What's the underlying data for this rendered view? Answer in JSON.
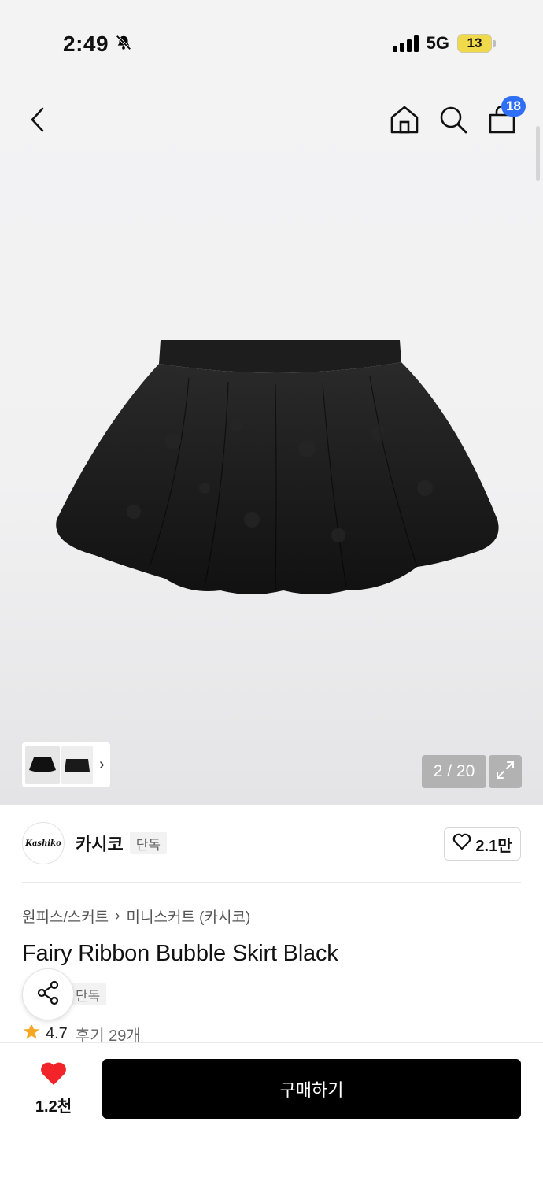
{
  "status_bar": {
    "time": "2:49",
    "network": "5G",
    "battery": "13"
  },
  "header": {
    "cart_count": "18",
    "icons": [
      "back-icon",
      "home-icon",
      "search-icon",
      "shopping-bag-icon"
    ]
  },
  "gallery": {
    "page_indicator": "2 / 20",
    "current_page": 2,
    "total_pages": 20
  },
  "brand": {
    "logo_text": "Kashiko",
    "name": "카시코",
    "tag": "단독",
    "likes": "2.1만"
  },
  "product": {
    "breadcrumb": [
      "원피스/스커트",
      "미니스커트 (카시코)"
    ],
    "title": "Fairy Ribbon Bubble Skirt Black",
    "tag": "단독",
    "rating": "4.7",
    "reviews": "후기 29개"
  },
  "bottom_bar": {
    "wish_count": "1.2천",
    "buy_label": "구매하기"
  },
  "colors": {
    "accent_blue": "#2f6ef6",
    "wish_red": "#f2242a",
    "star": "#f5a623",
    "buy_button": "#000000"
  }
}
